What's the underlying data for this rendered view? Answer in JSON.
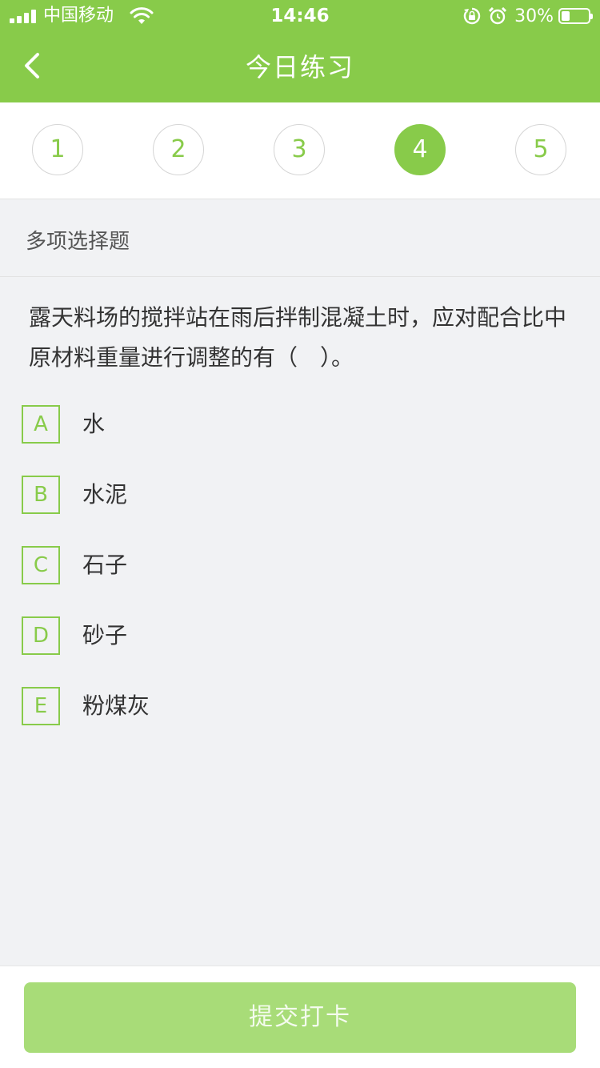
{
  "status_bar": {
    "carrier": "中国移动",
    "time": "14:46",
    "battery_percent": "30%",
    "battery_level": 0.3,
    "icons": [
      "signal-icon",
      "wifi-icon",
      "orientation-lock-icon",
      "alarm-icon",
      "battery-icon"
    ]
  },
  "header": {
    "title": "今日练习",
    "back_icon": "chevron-left-icon",
    "background_color": "#88cb4a"
  },
  "question_numbers": {
    "items": [
      "1",
      "2",
      "3",
      "4",
      "5"
    ],
    "active": "4"
  },
  "question": {
    "type": "多项选择题",
    "text": "露天料场的搅拌站在雨后拌制混凝土时，应对配合比中原材料重量进行调整的有（　）。",
    "options": [
      {
        "letter": "A",
        "text": "水"
      },
      {
        "letter": "B",
        "text": "水泥"
      },
      {
        "letter": "C",
        "text": "石子"
      },
      {
        "letter": "D",
        "text": "砂子"
      },
      {
        "letter": "E",
        "text": "粉煤灰"
      }
    ]
  },
  "footer": {
    "submit_label": "提交打卡"
  },
  "colors": {
    "accent": "#88cb4a",
    "button_disabled": "#a8dc78",
    "background": "#f1f2f4"
  }
}
